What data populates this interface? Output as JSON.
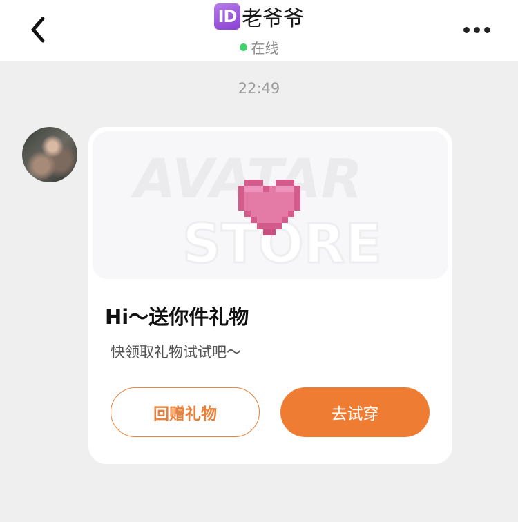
{
  "header": {
    "id_badge": "ID",
    "title": "老爷爷",
    "status": "在线",
    "status_color": "#41d36b",
    "back_icon": "chevron-left-icon",
    "more_icon": "more-dots-icon"
  },
  "chat": {
    "timestamp": "22:49",
    "message": {
      "image_alt": "AVATAR STORE",
      "image_icon": "pixel-heart-icon",
      "title": "Hi～送你件礼物",
      "subtitle": "快领取礼物试试吧～",
      "return_gift_label": "回赠礼物",
      "try_on_label": "去试穿"
    }
  },
  "colors": {
    "accent": "#ee7c33",
    "heart": "#e2719f"
  }
}
